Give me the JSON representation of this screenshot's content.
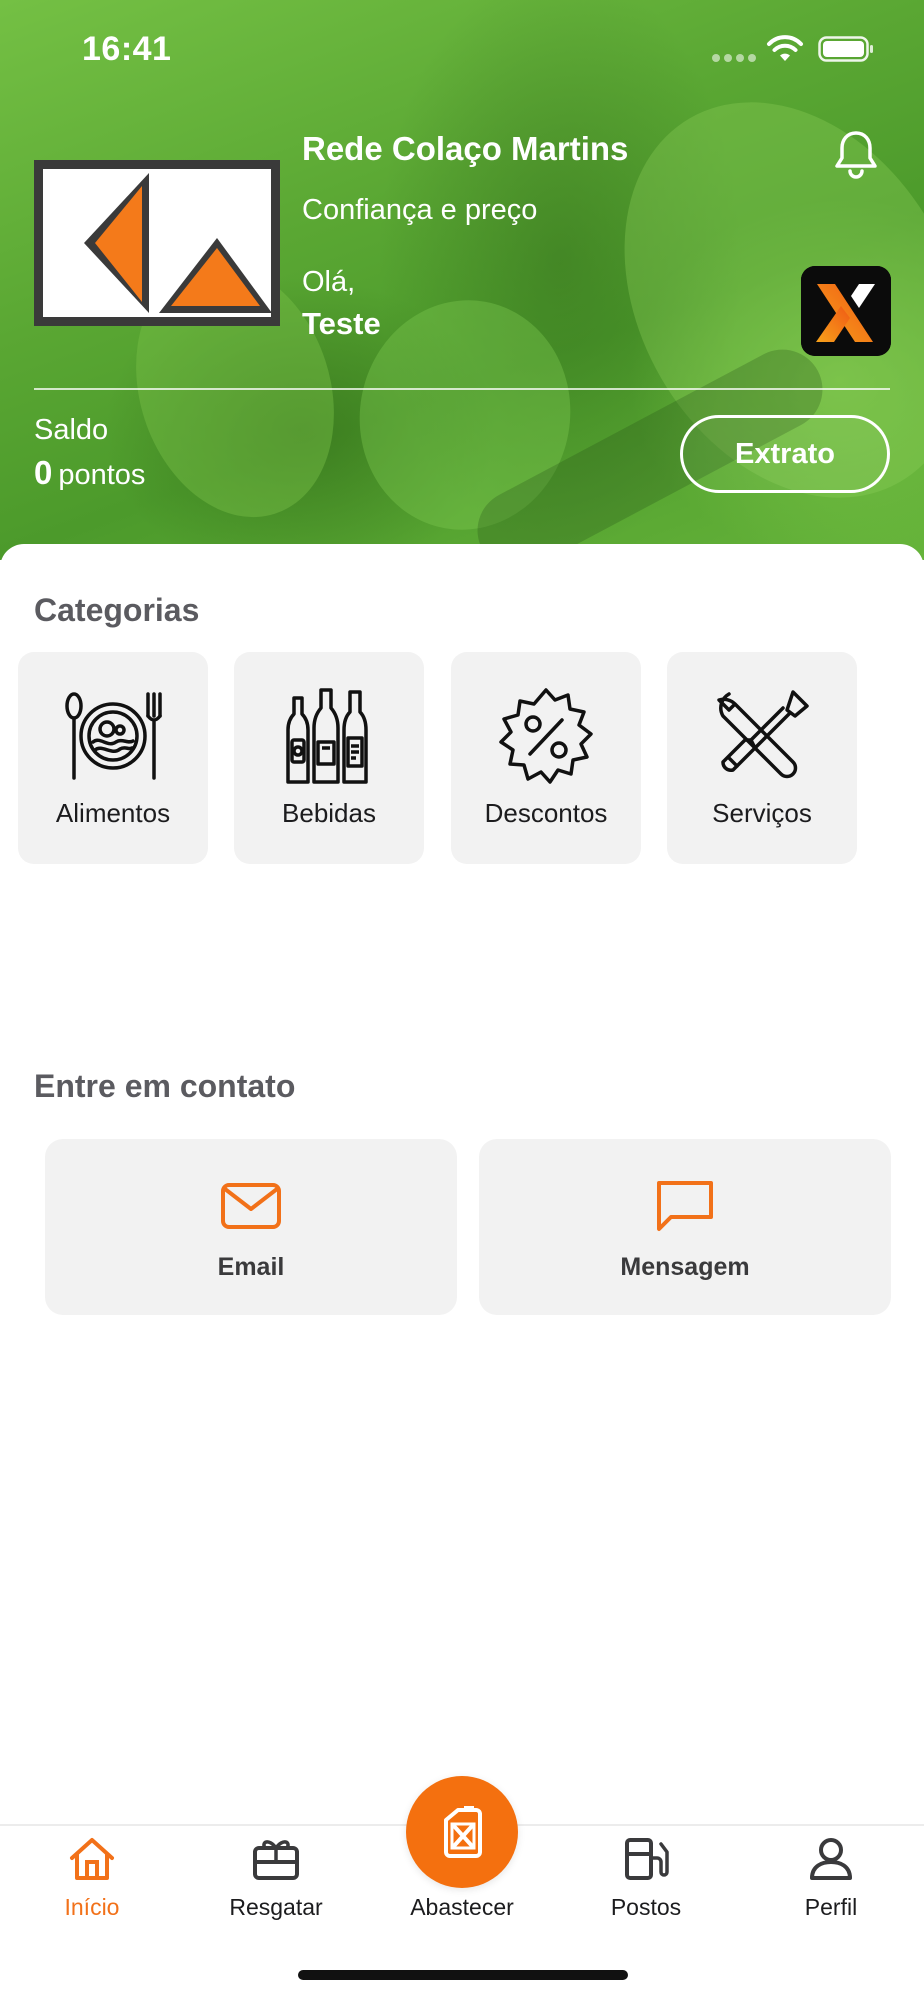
{
  "status_bar": {
    "time": "16:41"
  },
  "header": {
    "brand_name": "Rede Colaço Martins",
    "slogan": "Confiança e preço",
    "greeting": "Olá,",
    "user_name": "Teste",
    "logo_icon": "kw-brand-logo",
    "notification_icon": "bell-icon",
    "partner_badge_icon": "x-partner-logo"
  },
  "balance": {
    "label": "Saldo",
    "points": "0",
    "unit": "pontos",
    "statement_button": "Extrato"
  },
  "categories": {
    "title": "Categorias",
    "items": [
      {
        "label": "Alimentos",
        "icon": "food-plate-icon"
      },
      {
        "label": "Bebidas",
        "icon": "bottles-icon"
      },
      {
        "label": "Descontos",
        "icon": "discount-badge-icon"
      },
      {
        "label": "Serviços",
        "icon": "tools-icon"
      }
    ]
  },
  "contact": {
    "title": "Entre em contato",
    "items": [
      {
        "label": "Email",
        "icon": "mail-icon"
      },
      {
        "label": "Mensagem",
        "icon": "chat-bubble-icon"
      }
    ]
  },
  "tabbar": {
    "items": [
      {
        "label": "Início",
        "icon": "home-icon",
        "active": true
      },
      {
        "label": "Resgatar",
        "icon": "gift-card-icon"
      },
      {
        "label": "Abastecer",
        "icon": "fuel-can-icon"
      },
      {
        "label": "Postos",
        "icon": "gas-station-icon"
      },
      {
        "label": "Perfil",
        "icon": "user-icon"
      }
    ]
  },
  "colors": {
    "accent": "#F4700F",
    "hero_green": "#5AA733",
    "card_bg": "#F2F2F2",
    "section_title": "#5B5B60"
  }
}
